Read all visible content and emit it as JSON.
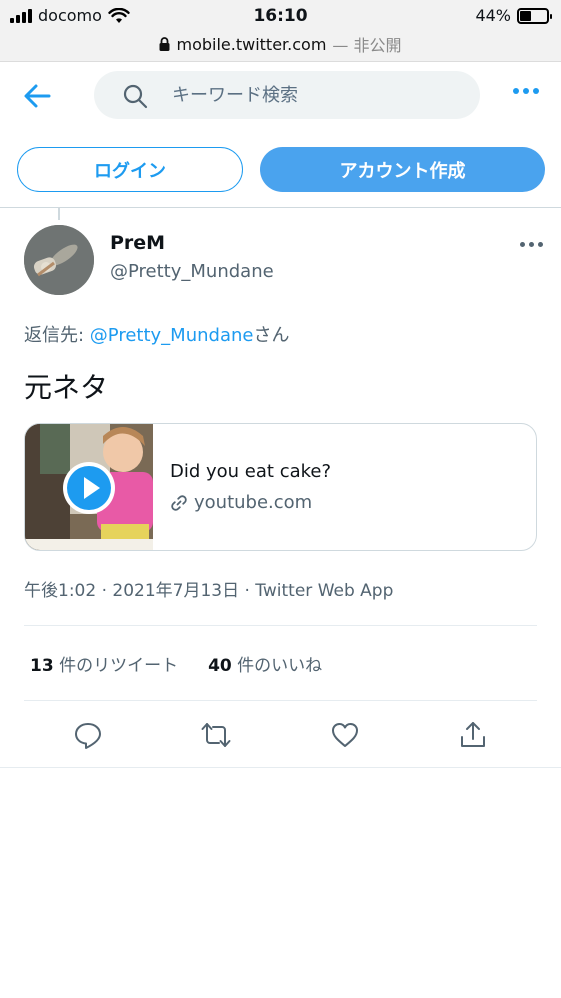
{
  "status_bar": {
    "carrier": "docomo",
    "time": "16:10",
    "battery": "44%",
    "battery_level": 0.44,
    "url": "mobile.twitter.com",
    "privacy": "— 非公開"
  },
  "header": {
    "search_placeholder": "キーワード検索"
  },
  "auth": {
    "login_label": "ログイン",
    "signup_label": "アカウント作成"
  },
  "tweet": {
    "name": "PreM",
    "handle": "@Pretty_Mundane",
    "reply_prefix": "返信先: ",
    "reply_handle": "@Pretty_Mundane",
    "reply_suffix": "さん",
    "text": "元ネタ",
    "card": {
      "title": "Did you eat cake?",
      "domain": "youtube.com"
    },
    "meta": "午後1:02 · 2021年7月13日 · Twitter Web App",
    "retweets_count": "13",
    "retweets_label": "件のリツイート",
    "likes_count": "40",
    "likes_label": "件のいいね"
  },
  "colors": {
    "accent": "#1d9bf0",
    "signup_bg": "#4aa3ee",
    "muted_text": "#536471"
  },
  "icons": [
    "back-arrow-icon",
    "search-icon",
    "more-icon",
    "play-icon",
    "link-icon",
    "reply-icon",
    "retweet-icon",
    "like-icon",
    "share-icon",
    "lock-icon",
    "wifi-icon",
    "battery-icon",
    "signal-icon"
  ]
}
